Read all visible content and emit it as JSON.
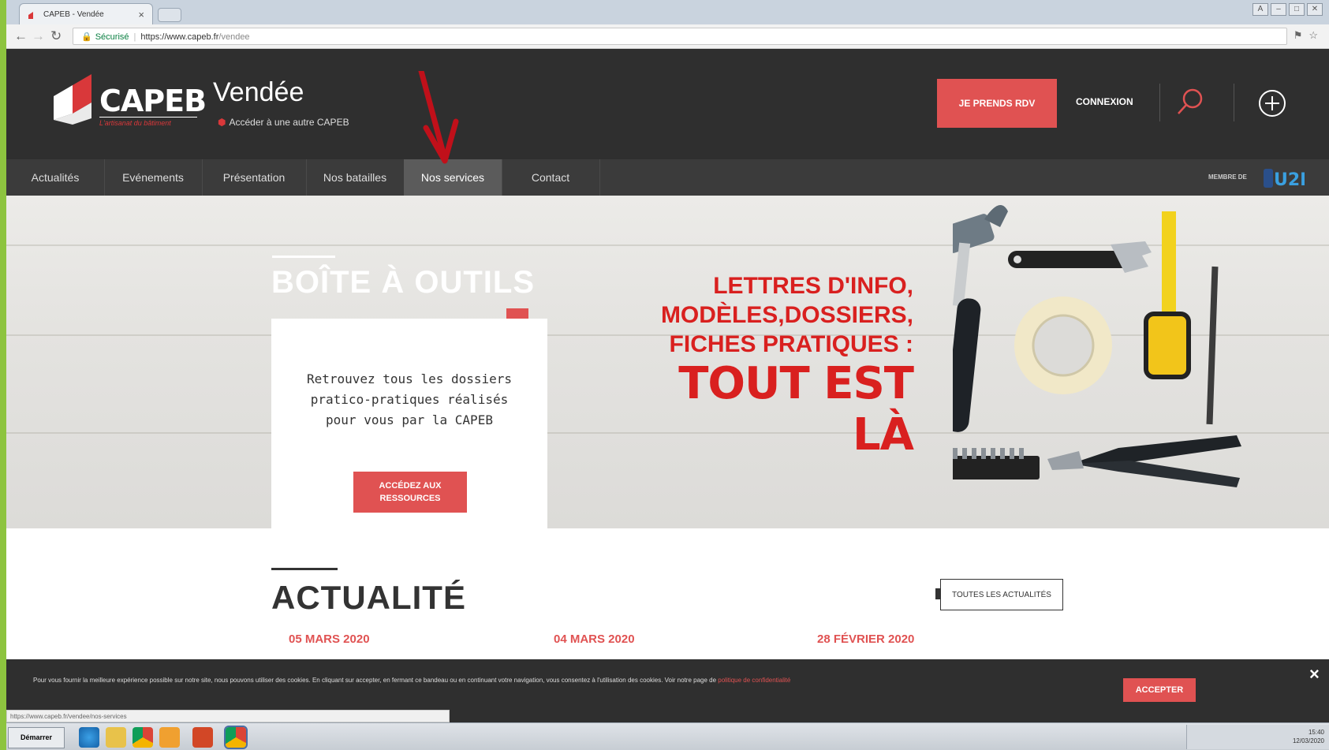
{
  "browser": {
    "tab_title": "CAPEB - Vendée",
    "tab_close": "×",
    "url_secure": "Sécurisé",
    "url_host": "https://www.capeb.fr",
    "url_path": "/vendee",
    "status_url": "https://www.capeb.fr/vendee/nos-services"
  },
  "header": {
    "logo_text": "CAPEB",
    "logo_tagline": "L'artisanat du bâtiment",
    "region": "Vendée",
    "other_capeb": "Accéder à une autre CAPEB",
    "rdv_label": "JE PRENDS RDV",
    "connexion_label": "CONNEXION"
  },
  "nav": {
    "items": [
      {
        "label": "Actualités"
      },
      {
        "label": "Evénements"
      },
      {
        "label": "Présentation"
      },
      {
        "label": "Nos batailles"
      },
      {
        "label": "Nos services"
      },
      {
        "label": "Contact"
      }
    ],
    "active_index": 4,
    "membre_label": "MEMBRE DE",
    "membre_logo": "U2P"
  },
  "hero": {
    "title": "BOÎTE À OUTILS",
    "card_text": "Retrouvez tous les dossiers pratico-pratiques réalisés pour vous par la CAPEB",
    "card_button": "ACCÉDEZ AUX RESSOURCES",
    "promo_lines": [
      "LETTRES D'INFO,",
      "MODÈLES,DOSSIERS,",
      "FICHES PRATIQUES :"
    ],
    "promo_big": "TOUT EST LÀ"
  },
  "news": {
    "title": "ACTUALITÉ",
    "all_button": "TOUTES LES ACTUALITÉS",
    "dates": [
      "05 MARS 2020",
      "04 MARS 2020",
      "28 FÉVRIER 2020"
    ]
  },
  "cookie": {
    "text": "Pour vous fournir la meilleure expérience possible sur notre site, nous pouvons utiliser des cookies. En cliquant sur accepter, en fermant ce bandeau ou en continuant votre navigation, vous consentez à l'utilisation des cookies. Voir notre page de",
    "link": "politique de confidentialité",
    "accept_label": "ACCEPTER",
    "close_label": "×"
  },
  "taskbar": {
    "start_label": "Démarrer",
    "time": "15:40",
    "date": "12/03/2020"
  },
  "colors": {
    "accent": "#e05252",
    "header_bg": "#2f2f2f",
    "nav_bg": "#3b3b3b",
    "promo_red": "#d9201f",
    "annotation_arrow": "#c0101a"
  }
}
